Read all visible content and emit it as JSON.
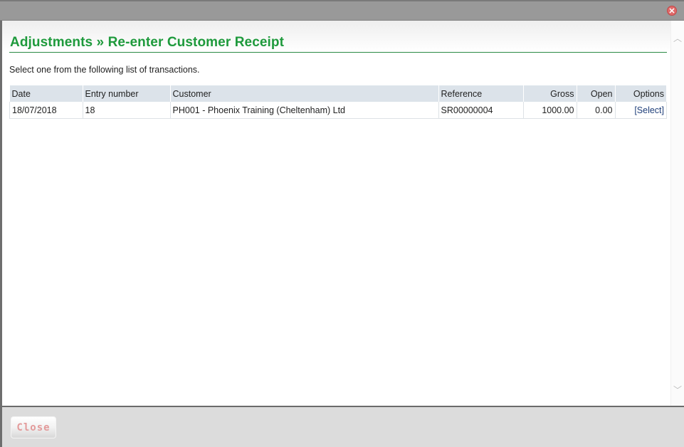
{
  "dialog": {
    "title": "Adjustments » Re-enter Customer Receipt",
    "instruction": "Select one from the following list of transactions.",
    "close_icon": "close-circle-icon"
  },
  "table": {
    "headers": [
      "Date",
      "Entry number",
      "Customer",
      "Reference",
      "Gross",
      "Open",
      "Options"
    ],
    "rows": [
      {
        "date": "18/07/2018",
        "entry_number": "18",
        "customer": "PH001 - Phoenix Training (Cheltenham) Ltd",
        "reference": "SR00000004",
        "gross": "1000.00",
        "open": "0.00",
        "option": "[Select]"
      }
    ]
  },
  "footer": {
    "close_label": "Close"
  },
  "colors": {
    "title": "#1e9a3c",
    "header_bg": "#dce3ea",
    "link": "#1f3f7a",
    "close_text": "#e39a9a"
  }
}
